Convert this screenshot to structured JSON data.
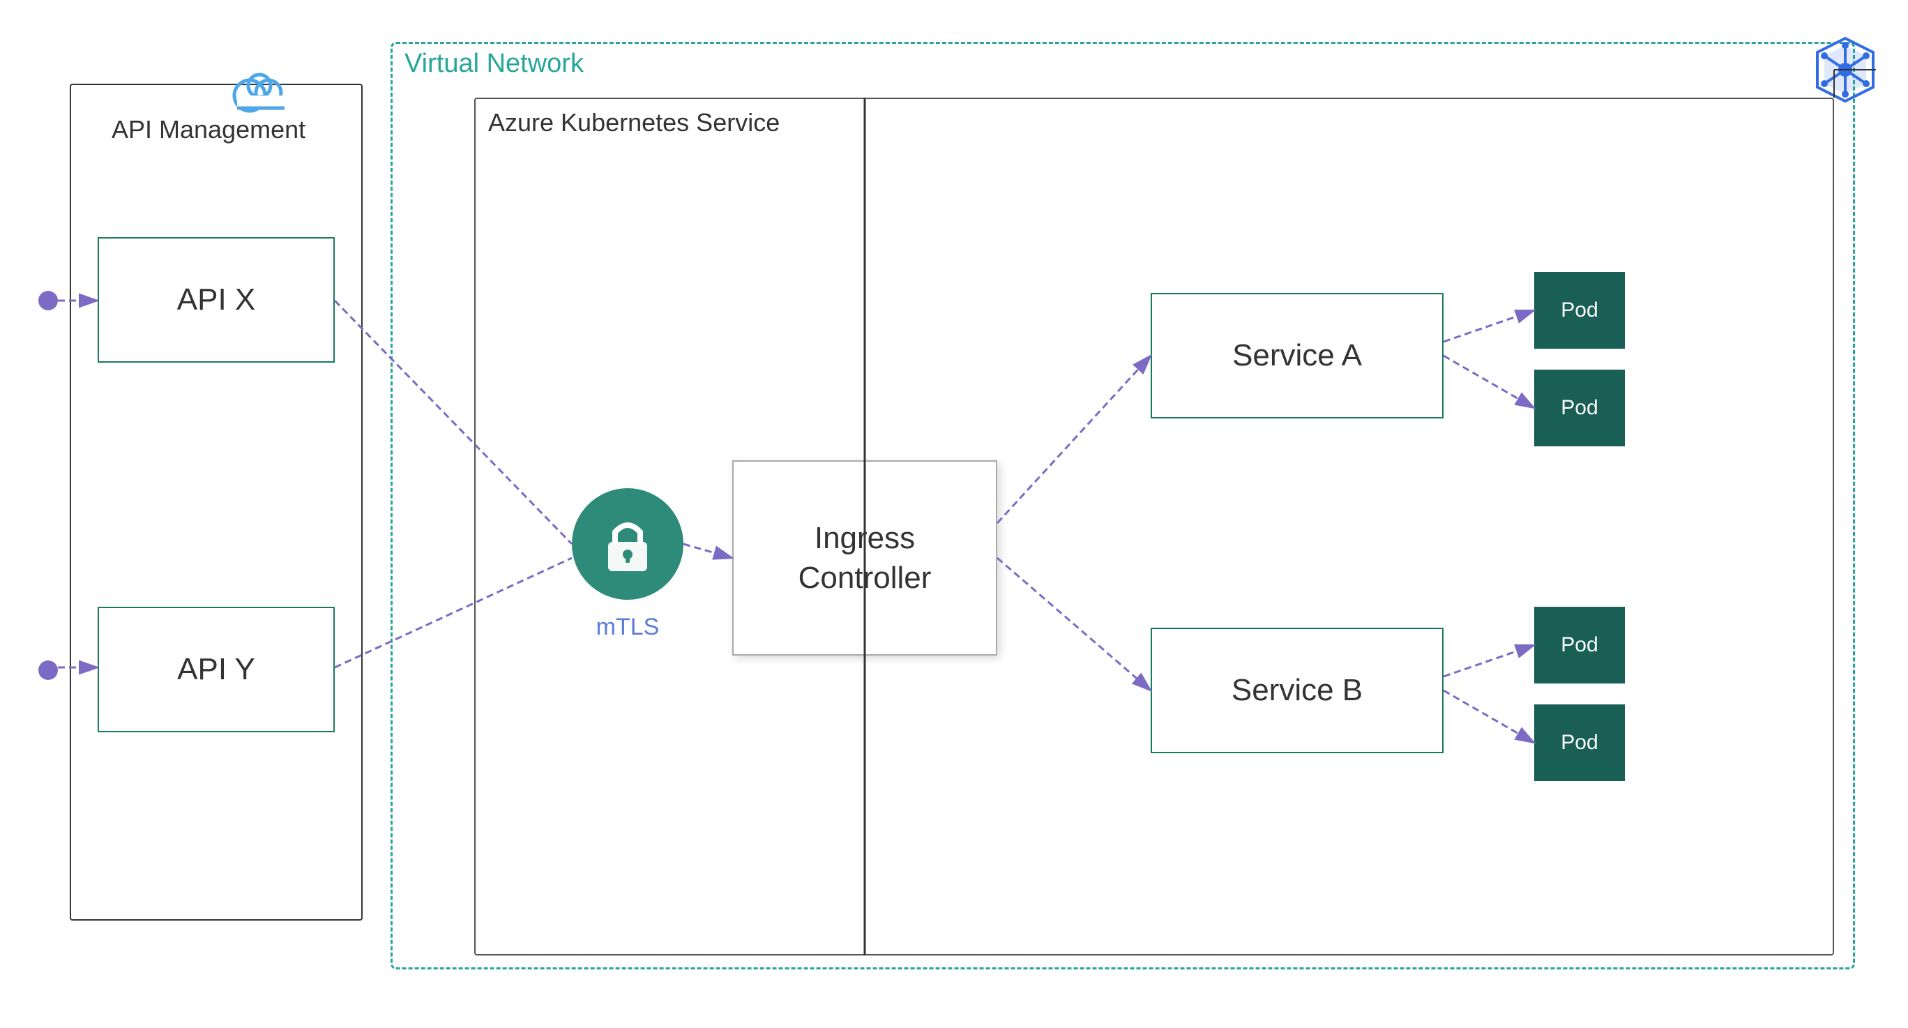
{
  "virtualNetwork": {
    "label": "Virtual Network"
  },
  "aks": {
    "label": "Azure Kubernetes Service"
  },
  "apim": {
    "label": "API Management"
  },
  "apiX": {
    "label": "API X"
  },
  "apiY": {
    "label": "API Y"
  },
  "ingress": {
    "label": "Ingress\nController"
  },
  "serviceA": {
    "label": "Service A"
  },
  "serviceB": {
    "label": "Service B"
  },
  "pods": {
    "label": "Pod"
  },
  "mtls": {
    "label": "mTLS"
  },
  "colors": {
    "teal": "#26a69a",
    "darkTeal": "#1a7a5e",
    "purple": "#7c6bc4",
    "podBg": "#1a5f55",
    "mtlsCircle": "#2e8b7a"
  }
}
